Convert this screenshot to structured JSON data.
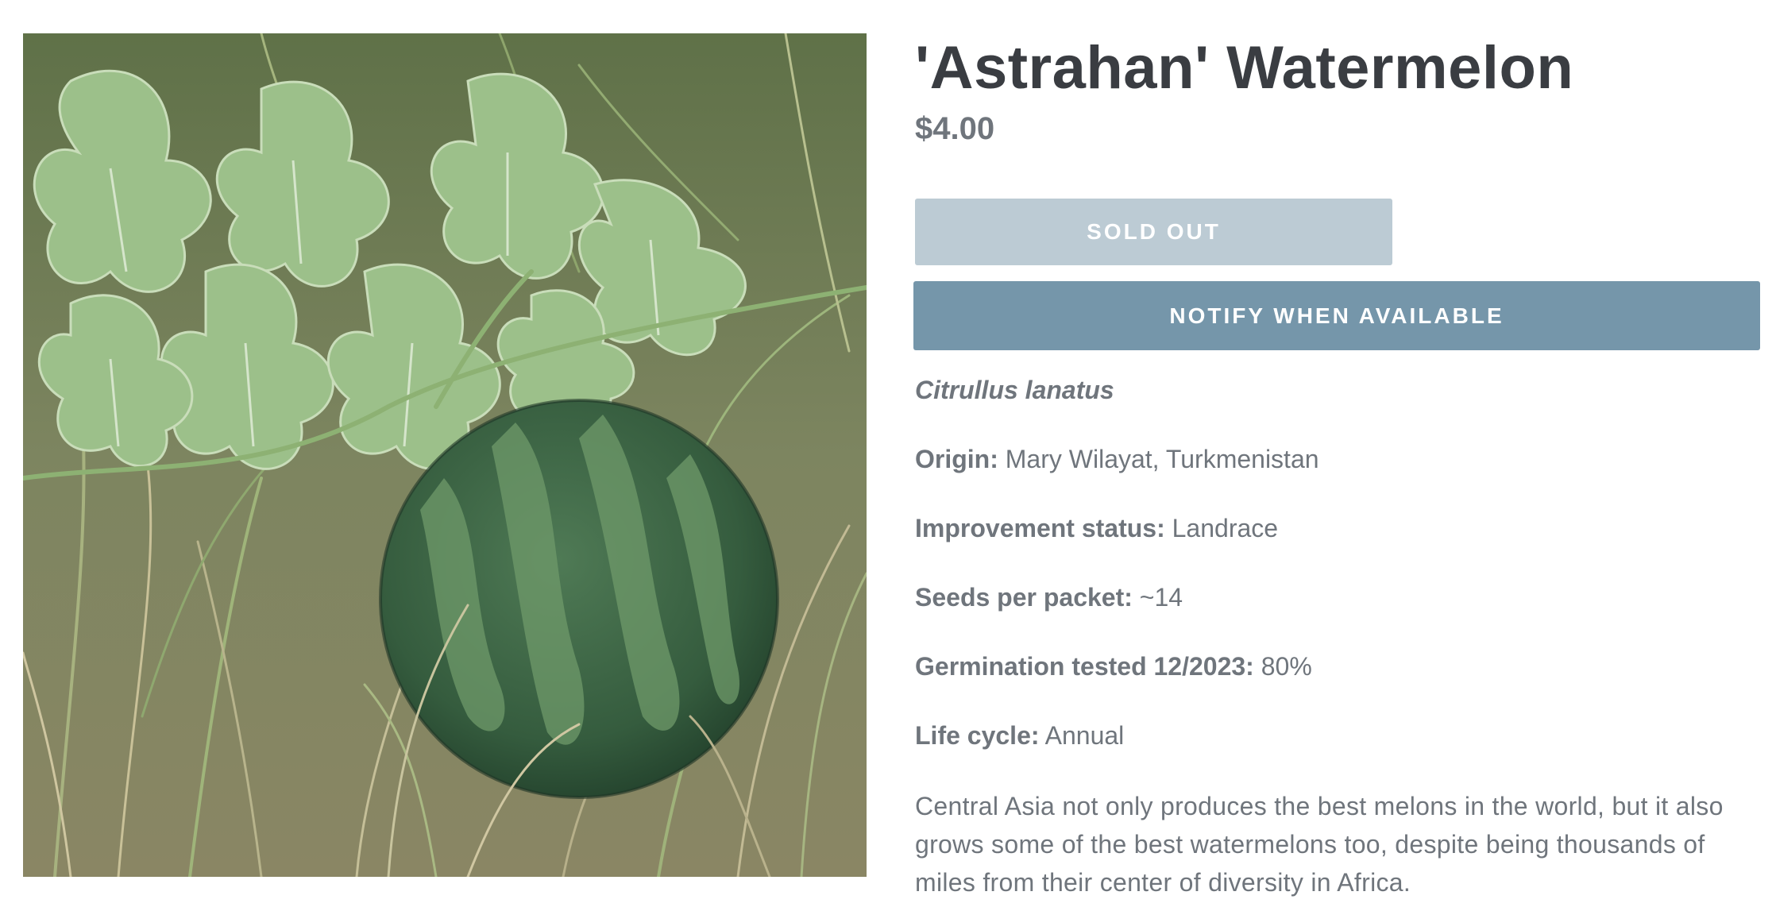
{
  "product": {
    "title": "'Astrahan' Watermelon",
    "price": "$4.00",
    "image_alt": "Watermelon growing among leaves and grass"
  },
  "buttons": {
    "sold_out_label": "Sold out",
    "notify_label": "Notify when available"
  },
  "details": {
    "scientific_name": "Citrullus lanatus",
    "rows": [
      {
        "label": "Origin:",
        "value": "Mary Wilayat, Turkmenistan"
      },
      {
        "label": "Improvement status:",
        "value": "Landrace"
      },
      {
        "label": "Seeds per packet:",
        "value": "~14"
      },
      {
        "label": "Germination tested 12/2023:",
        "value": "80%"
      },
      {
        "label": "Life cycle:",
        "value": "Annual"
      }
    ],
    "description": "Central Asia not only produces the best melons in the world, but it also grows some of the best watermelons too, despite being thousands of miles from their center of diversity in Africa."
  },
  "colors": {
    "title": "#3a3d42",
    "body_text": "#6f757c",
    "sold_out_button": "#bccbd4",
    "notify_button": "#7596aa"
  }
}
